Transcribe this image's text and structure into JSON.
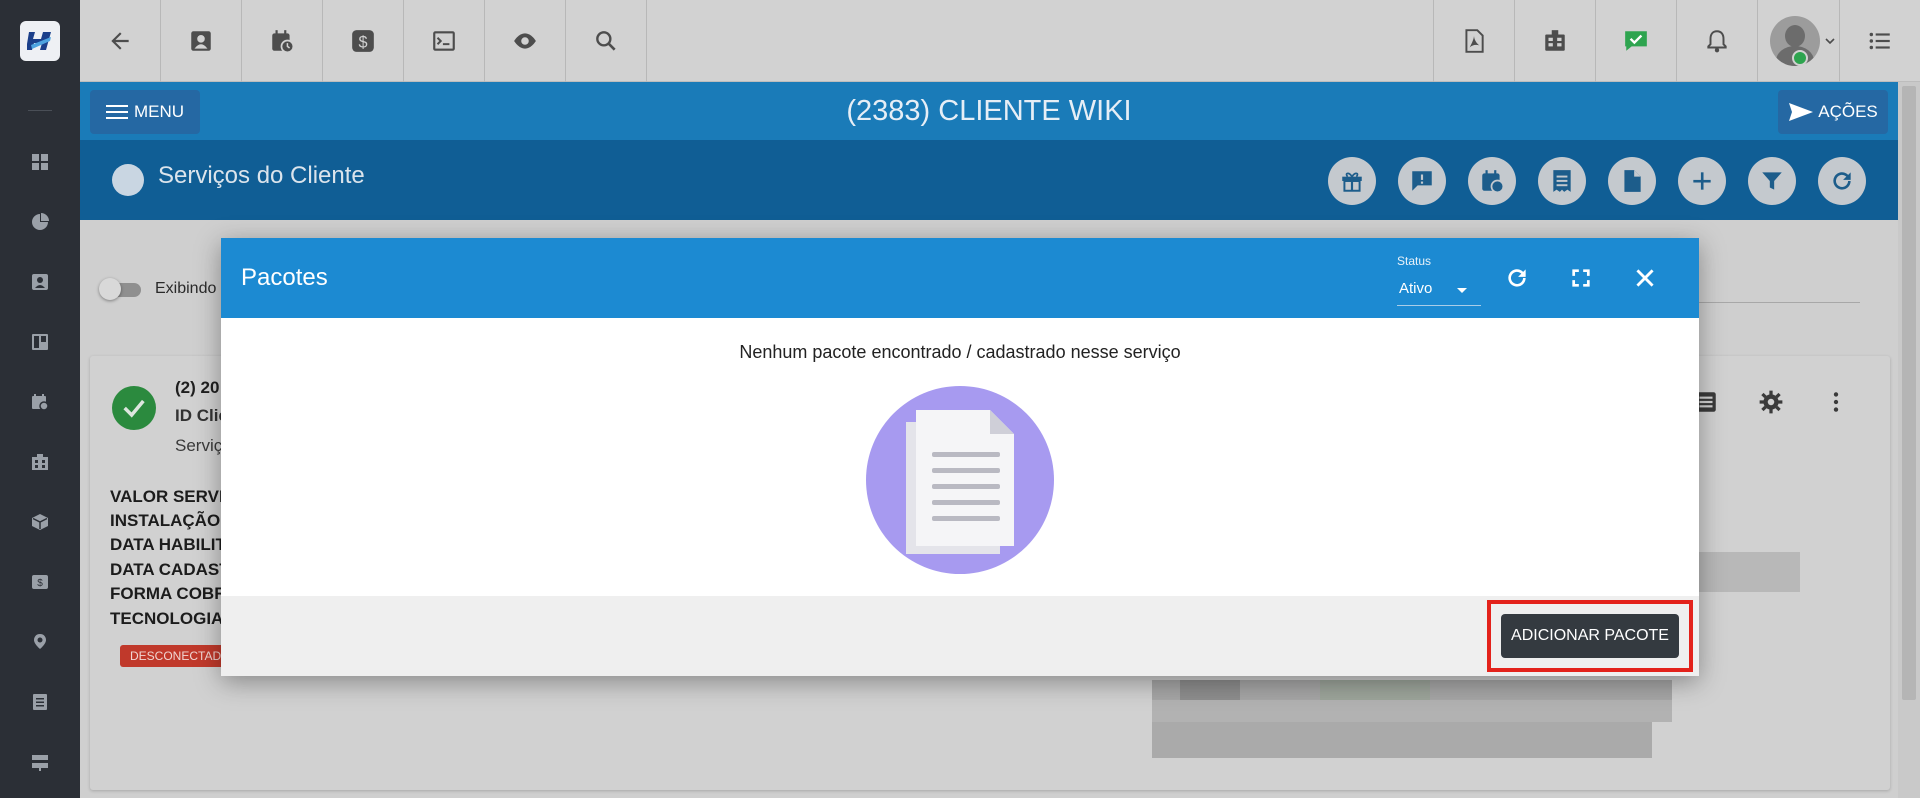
{
  "header": {
    "title": "(2383) CLIENTE WIKI",
    "menu_label": "MENU",
    "acoes_label": "AÇÕES"
  },
  "section": {
    "title": "Serviços do Cliente"
  },
  "background": {
    "toggle_label": "Exibindo a",
    "card_line1": "(2) 20",
    "card_line2": "ID Clie",
    "card_line3": "Serviç",
    "info_lines": [
      "VALOR SERVIÇ",
      "INSTALAÇÃO:",
      "DATA HABILIT",
      "DATA CADAST",
      "FORMA COBRA",
      "TECNOLOGIA I"
    ],
    "status_badge": "DESCONECTAD"
  },
  "modal": {
    "title": "Pacotes",
    "status_label": "Status",
    "status_value": "Ativo",
    "empty_message": "Nenhum pacote encontrado / cadastrado nesse serviço",
    "add_button": "ADICIONAR PACOTE"
  },
  "colors": {
    "header_blue": "#1a7bb8",
    "modal_header_blue": "#1c8ad2",
    "highlight_red": "#e3221b",
    "empty_illustration": "#a79af0"
  }
}
